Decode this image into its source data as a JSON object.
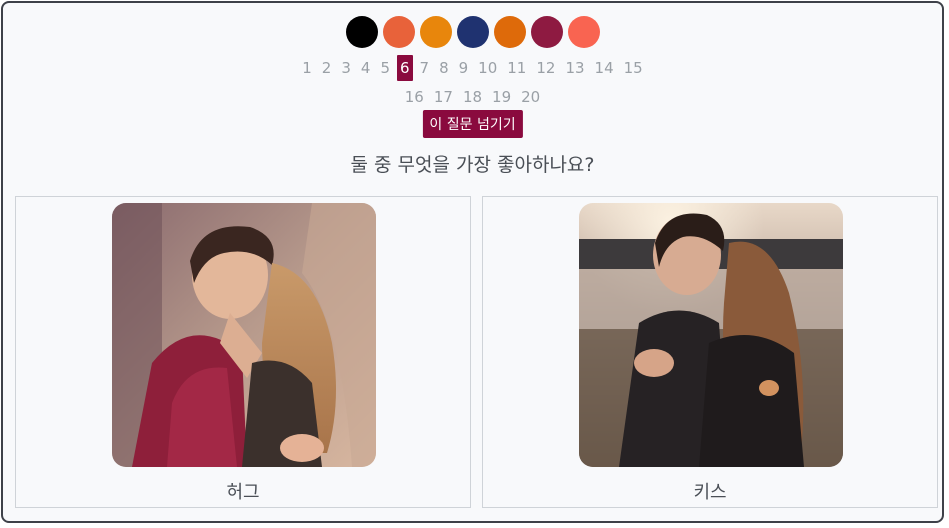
{
  "color_picker": {
    "swatches": [
      "#000000",
      "#e8623a",
      "#e8860c",
      "#1f3270",
      "#de6a0a",
      "#8e1a41",
      "#f96451"
    ]
  },
  "pagination": {
    "row1": [
      "1",
      "2",
      "3",
      "4",
      "5",
      "6",
      "7",
      "8",
      "9",
      "10",
      "11",
      "12",
      "13",
      "14",
      "15"
    ],
    "row2": [
      "16",
      "17",
      "18",
      "19",
      "20"
    ],
    "current": "6",
    "active_color": "#8a0a3e"
  },
  "skip_button": {
    "label": "이 질문 넘기기"
  },
  "question": {
    "text": "둘 중 무엇을 가장 좋아하나요?"
  },
  "options": [
    {
      "label": "허그",
      "image_icon": "couple-hug-photo"
    },
    {
      "label": "키스",
      "image_icon": "couple-kiss-photo"
    }
  ]
}
